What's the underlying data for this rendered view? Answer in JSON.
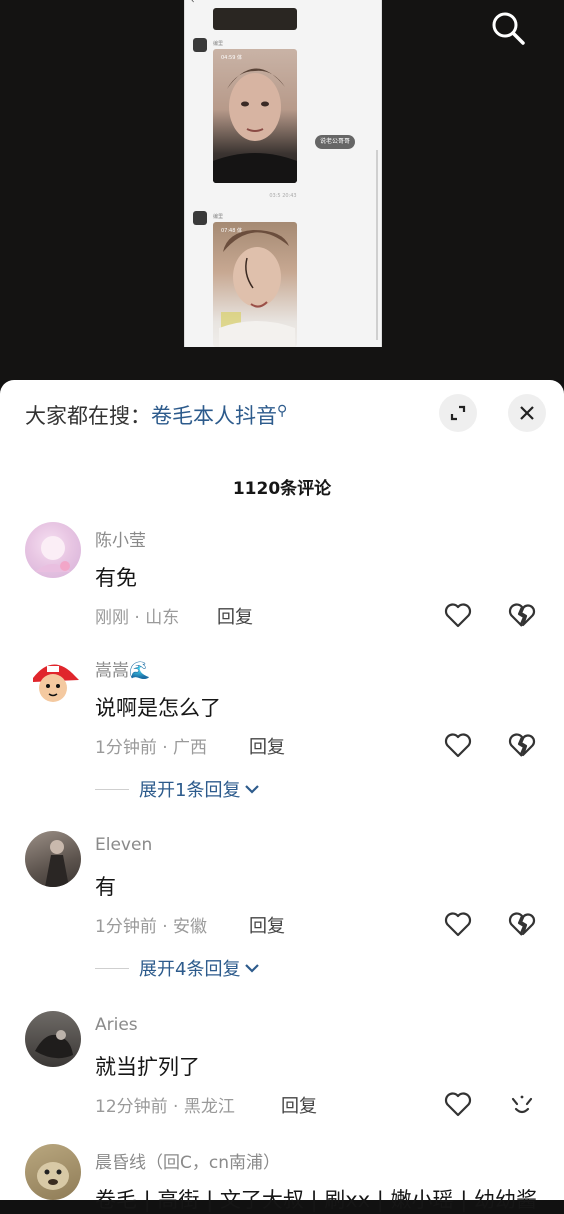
{
  "video": {
    "search_icon": "search-icon",
    "chat_image": {
      "title": "",
      "photo1_time": "04:59 体",
      "photo2_time": "07:48 体",
      "chip_label": "说老公哥哥",
      "timestamp": "03:5 20:43"
    }
  },
  "sheet": {
    "search_prefix": "大家都在搜：",
    "search_keyword": "卷毛本人抖音",
    "expand_icon": "expand-icon",
    "close_icon": "close-icon",
    "comments_count": "1120条评论"
  },
  "comments": [
    {
      "name": "陈小莹",
      "text": "有免",
      "meta": "刚刚 · 山东",
      "reply": "回复"
    },
    {
      "name": "嵩嵩🌊",
      "text": "说啊是怎么了",
      "meta": "1分钟前 · 广西",
      "reply": "回复",
      "expand": "展开1条回复"
    },
    {
      "name": "Eleven",
      "text": "有",
      "meta": "1分钟前 · 安徽",
      "reply": "回复",
      "expand": "展开4条回复"
    },
    {
      "name": "Aries",
      "text": "就当扩列了",
      "meta": "12分钟前 · 黑龙江",
      "reply": "回复"
    },
    {
      "name": "晨昏线（回C，cn南浦）",
      "text": "卷毛 | 高街 | 文了大叔 | 刷xx | 嫩小瑶 | 幼幼酱"
    }
  ],
  "colors": {
    "link": "#2d5b8c",
    "meta": "#9a9a9a"
  }
}
